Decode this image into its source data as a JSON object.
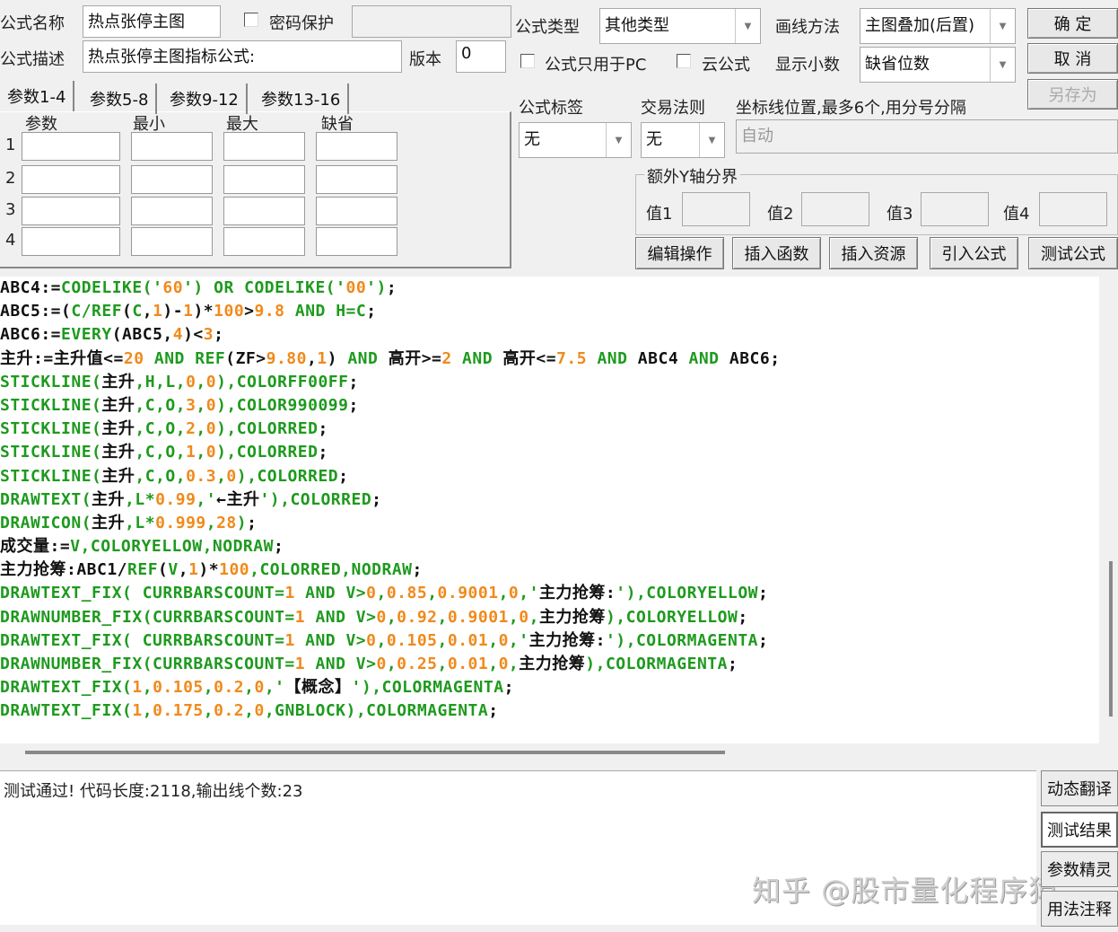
{
  "top": {
    "name_label": "公式名称",
    "name_value": "热点张停主图",
    "password_label": "密码保护",
    "desc_label": "公式描述",
    "desc_value": "热点张停主图指标公式:",
    "version_label": "版本",
    "version_value": "0",
    "type_label": "公式类型",
    "type_value": "其他类型",
    "draw_label": "画线方法",
    "draw_value": "主图叠加(后置)",
    "pc_only_label": "公式只用于PC",
    "cloud_label": "云公式",
    "decimal_label": "显示小数",
    "decimal_value": "缺省位数",
    "ok": "确  定",
    "cancel": "取  消",
    "save_as": "另存为",
    "tag_label": "公式标签",
    "tag_value": "无",
    "trade_label": "交易法则",
    "trade_value": "无",
    "axis_label": "坐标线位置,最多6个,用分号分隔",
    "axis_placeholder": "自动",
    "yaxis_group": "额外Y轴分界",
    "yvals": [
      "值1",
      "值2",
      "值3",
      "值4"
    ],
    "actions": [
      "编辑操作",
      "插入函数",
      "插入资源",
      "引入公式",
      "测试公式"
    ]
  },
  "params": {
    "tabs": [
      "参数1-4",
      "参数5-8",
      "参数9-12",
      "参数13-16"
    ],
    "headers": [
      "参数",
      "最小",
      "最大",
      "缺省"
    ],
    "rows": [
      "1",
      "2",
      "3",
      "4"
    ]
  },
  "code": [
    [
      [
        "k",
        "ABC4:="
      ],
      [
        "g",
        "CODELIKE('"
      ],
      [
        "o",
        "60"
      ],
      [
        "g",
        "') OR CODELIKE('"
      ],
      [
        "o",
        "00"
      ],
      [
        "g",
        "')"
      ],
      [
        "k",
        ";"
      ]
    ],
    [
      [
        "k",
        "ABC5:=("
      ],
      [
        "g",
        "C/REF"
      ],
      [
        "k",
        "("
      ],
      [
        "g",
        "C"
      ],
      [
        "k",
        ","
      ],
      [
        "o",
        "1"
      ],
      [
        "k",
        ")-"
      ],
      [
        "o",
        "1"
      ],
      [
        "k",
        ")*"
      ],
      [
        "o",
        "100"
      ],
      [
        "k",
        ">"
      ],
      [
        "o",
        "9.8"
      ],
      [
        "g",
        " AND H=C"
      ],
      [
        "k",
        ";"
      ]
    ],
    [
      [
        "k",
        "ABC6:="
      ],
      [
        "g",
        "EVERY"
      ],
      [
        "k",
        "(ABC5,"
      ],
      [
        "o",
        "4"
      ],
      [
        "k",
        ")<"
      ],
      [
        "o",
        "3"
      ],
      [
        "k",
        ";"
      ]
    ],
    [
      [
        "k",
        "主升:=主升值<="
      ],
      [
        "o",
        "20"
      ],
      [
        "g",
        " AND REF"
      ],
      [
        "k",
        "(ZF>"
      ],
      [
        "o",
        "9.80"
      ],
      [
        "k",
        ","
      ],
      [
        "o",
        "1"
      ],
      [
        "k",
        ") "
      ],
      [
        "g",
        "AND"
      ],
      [
        "k",
        " 高开>="
      ],
      [
        "o",
        "2"
      ],
      [
        "g",
        " AND"
      ],
      [
        "k",
        " 高开<="
      ],
      [
        "o",
        "7.5"
      ],
      [
        "g",
        " AND"
      ],
      [
        "k",
        " ABC4 "
      ],
      [
        "g",
        "AND"
      ],
      [
        "k",
        " ABC6;"
      ]
    ],
    [
      [
        "g",
        "STICKLINE("
      ],
      [
        "k",
        "主升"
      ],
      [
        "g",
        ",H,L,"
      ],
      [
        "o",
        "0"
      ],
      [
        "g",
        ","
      ],
      [
        "o",
        "0"
      ],
      [
        "g",
        "),COLORFF00FF"
      ],
      [
        "k",
        ";"
      ]
    ],
    [
      [
        "g",
        "STICKLINE("
      ],
      [
        "k",
        "主升"
      ],
      [
        "g",
        ",C,O,"
      ],
      [
        "o",
        "3"
      ],
      [
        "g",
        ","
      ],
      [
        "o",
        "0"
      ],
      [
        "g",
        "),COLOR990099"
      ],
      [
        "k",
        ";"
      ]
    ],
    [
      [
        "g",
        "STICKLINE("
      ],
      [
        "k",
        "主升"
      ],
      [
        "g",
        ",C,O,"
      ],
      [
        "o",
        "2"
      ],
      [
        "g",
        ","
      ],
      [
        "o",
        "0"
      ],
      [
        "g",
        "),COLORRED"
      ],
      [
        "k",
        ";"
      ]
    ],
    [
      [
        "g",
        "STICKLINE("
      ],
      [
        "k",
        "主升"
      ],
      [
        "g",
        ",C,O,"
      ],
      [
        "o",
        "1"
      ],
      [
        "g",
        ","
      ],
      [
        "o",
        "0"
      ],
      [
        "g",
        "),COLORRED"
      ],
      [
        "k",
        ";"
      ]
    ],
    [
      [
        "g",
        "STICKLINE("
      ],
      [
        "k",
        "主升"
      ],
      [
        "g",
        ",C,O,"
      ],
      [
        "o",
        "0.3"
      ],
      [
        "g",
        ","
      ],
      [
        "o",
        "0"
      ],
      [
        "g",
        "),COLORRED"
      ],
      [
        "k",
        ";"
      ]
    ],
    [
      [
        "g",
        "DRAWTEXT("
      ],
      [
        "k",
        "主升"
      ],
      [
        "g",
        ",L*"
      ],
      [
        "o",
        "0.99"
      ],
      [
        "g",
        ",'"
      ],
      [
        "k",
        "←主升"
      ],
      [
        "g",
        "'),COLORRED"
      ],
      [
        "k",
        ";"
      ]
    ],
    [
      [
        "g",
        "DRAWICON("
      ],
      [
        "k",
        "主升"
      ],
      [
        "g",
        ",L*"
      ],
      [
        "o",
        "0.999"
      ],
      [
        "g",
        ","
      ],
      [
        "o",
        "28"
      ],
      [
        "g",
        ")"
      ],
      [
        "k",
        ";"
      ]
    ],
    [
      [
        "k",
        "成交量:="
      ],
      [
        "g",
        "V,COLORYELLOW,NODRAW"
      ],
      [
        "k",
        ";"
      ]
    ],
    [
      [
        "k",
        "主力抢筹:ABC1/"
      ],
      [
        "g",
        "REF"
      ],
      [
        "k",
        "("
      ],
      [
        "g",
        "V"
      ],
      [
        "k",
        ","
      ],
      [
        "o",
        "1"
      ],
      [
        "k",
        ")*"
      ],
      [
        "o",
        "100"
      ],
      [
        "g",
        ",COLORRED,NODRAW"
      ],
      [
        "k",
        ";"
      ]
    ],
    [
      [
        "g",
        "DRAWTEXT_FIX( CURRBARSCOUNT="
      ],
      [
        "o",
        "1"
      ],
      [
        "g",
        " AND V>"
      ],
      [
        "o",
        "0"
      ],
      [
        "g",
        ","
      ],
      [
        "o",
        "0.85"
      ],
      [
        "g",
        ","
      ],
      [
        "o",
        "0.9001"
      ],
      [
        "g",
        ","
      ],
      [
        "o",
        "0"
      ],
      [
        "g",
        ",'"
      ],
      [
        "k",
        "主力抢筹:"
      ],
      [
        "g",
        "'),COLORYELLOW"
      ],
      [
        "k",
        ";"
      ]
    ],
    [
      [
        "g",
        "DRAWNUMBER_FIX(CURRBARSCOUNT="
      ],
      [
        "o",
        "1"
      ],
      [
        "g",
        " AND V>"
      ],
      [
        "o",
        "0"
      ],
      [
        "g",
        ","
      ],
      [
        "o",
        "0.92"
      ],
      [
        "g",
        ","
      ],
      [
        "o",
        "0.9001"
      ],
      [
        "g",
        ","
      ],
      [
        "o",
        "0"
      ],
      [
        "g",
        ","
      ],
      [
        "k",
        "主力抢筹"
      ],
      [
        "g",
        "),COLORYELLOW"
      ],
      [
        "k",
        ";"
      ]
    ],
    [
      [
        "g",
        "DRAWTEXT_FIX( CURRBARSCOUNT="
      ],
      [
        "o",
        "1"
      ],
      [
        "g",
        " AND V>"
      ],
      [
        "o",
        "0"
      ],
      [
        "g",
        ","
      ],
      [
        "o",
        "0.105"
      ],
      [
        "g",
        ","
      ],
      [
        "o",
        "0.01"
      ],
      [
        "g",
        ","
      ],
      [
        "o",
        "0"
      ],
      [
        "g",
        ",'"
      ],
      [
        "k",
        "主力抢筹:"
      ],
      [
        "g",
        "'),COLORMAGENTA"
      ],
      [
        "k",
        ";"
      ]
    ],
    [
      [
        "g",
        "DRAWNUMBER_FIX(CURRBARSCOUNT="
      ],
      [
        "o",
        "1"
      ],
      [
        "g",
        " AND V>"
      ],
      [
        "o",
        "0"
      ],
      [
        "g",
        ","
      ],
      [
        "o",
        "0.25"
      ],
      [
        "g",
        ","
      ],
      [
        "o",
        "0.01"
      ],
      [
        "g",
        ","
      ],
      [
        "o",
        "0"
      ],
      [
        "g",
        ","
      ],
      [
        "k",
        "主力抢筹"
      ],
      [
        "g",
        "),COLORMAGENTA"
      ],
      [
        "k",
        ";"
      ]
    ],
    [
      [
        "g",
        "DRAWTEXT_FIX("
      ],
      [
        "o",
        "1"
      ],
      [
        "g",
        ","
      ],
      [
        "o",
        "0.105"
      ],
      [
        "g",
        ","
      ],
      [
        "o",
        "0.2"
      ],
      [
        "g",
        ","
      ],
      [
        "o",
        "0"
      ],
      [
        "g",
        ",'"
      ],
      [
        "k",
        "【概念】"
      ],
      [
        "g",
        "'),COLORMAGENTA"
      ],
      [
        "k",
        ";"
      ]
    ],
    [
      [
        "g",
        "DRAWTEXT_FIX("
      ],
      [
        "o",
        "1"
      ],
      [
        "g",
        ","
      ],
      [
        "o",
        "0.175"
      ],
      [
        "g",
        ","
      ],
      [
        "o",
        "0.2"
      ],
      [
        "g",
        ","
      ],
      [
        "o",
        "0"
      ],
      [
        "g",
        ",GNBLOCK),COLORMAGENTA"
      ],
      [
        "k",
        ";"
      ]
    ]
  ],
  "output": {
    "message": "测试通过! 代码长度:2118,输出线个数:23",
    "side_buttons": [
      "动态翻译",
      "测试结果",
      "参数精灵",
      "用法注释"
    ],
    "watermark": "知乎 @股市量化程序猿"
  },
  "colors": {
    "keyword": "#1e9a1e",
    "number": "#f08a1c",
    "text": "#111111"
  }
}
